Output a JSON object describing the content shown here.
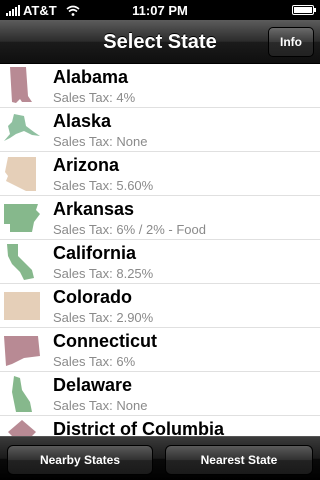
{
  "status_bar": {
    "carrier": "AT&T",
    "time": "11:07 PM",
    "battery": 1.0
  },
  "nav": {
    "title": "Select State",
    "info_label": "Info"
  },
  "states": [
    {
      "name": "Alabama",
      "tax": "Sales Tax: 4%",
      "icon": "alabama-shape-icon",
      "color": "#b88a94"
    },
    {
      "name": "Alaska",
      "tax": "Sales Tax: None",
      "icon": "alaska-shape-icon",
      "color": "#8fc0a0"
    },
    {
      "name": "Arizona",
      "tax": "Sales Tax: 5.60%",
      "icon": "arizona-shape-icon",
      "color": "#e5cfb8"
    },
    {
      "name": "Arkansas",
      "tax": "Sales Tax: 6% / 2% - Food",
      "icon": "arkansas-shape-icon",
      "color": "#86b88c"
    },
    {
      "name": "California",
      "tax": "Sales Tax: 8.25%",
      "icon": "california-shape-icon",
      "color": "#86b88c"
    },
    {
      "name": "Colorado",
      "tax": "Sales Tax: 2.90%",
      "icon": "colorado-shape-icon",
      "color": "#e5cfb8"
    },
    {
      "name": "Connecticut",
      "tax": "Sales Tax: 6%",
      "icon": "connecticut-shape-icon",
      "color": "#b88a94"
    },
    {
      "name": "Delaware",
      "tax": "Sales Tax: None",
      "icon": "delaware-shape-icon",
      "color": "#86b88c"
    },
    {
      "name": "District of Columbia",
      "tax": "",
      "icon": "dc-shape-icon",
      "color": "#b88a94"
    }
  ],
  "tab_bar": {
    "nearby_label": "Nearby States",
    "nearest_label": "Nearest State"
  }
}
